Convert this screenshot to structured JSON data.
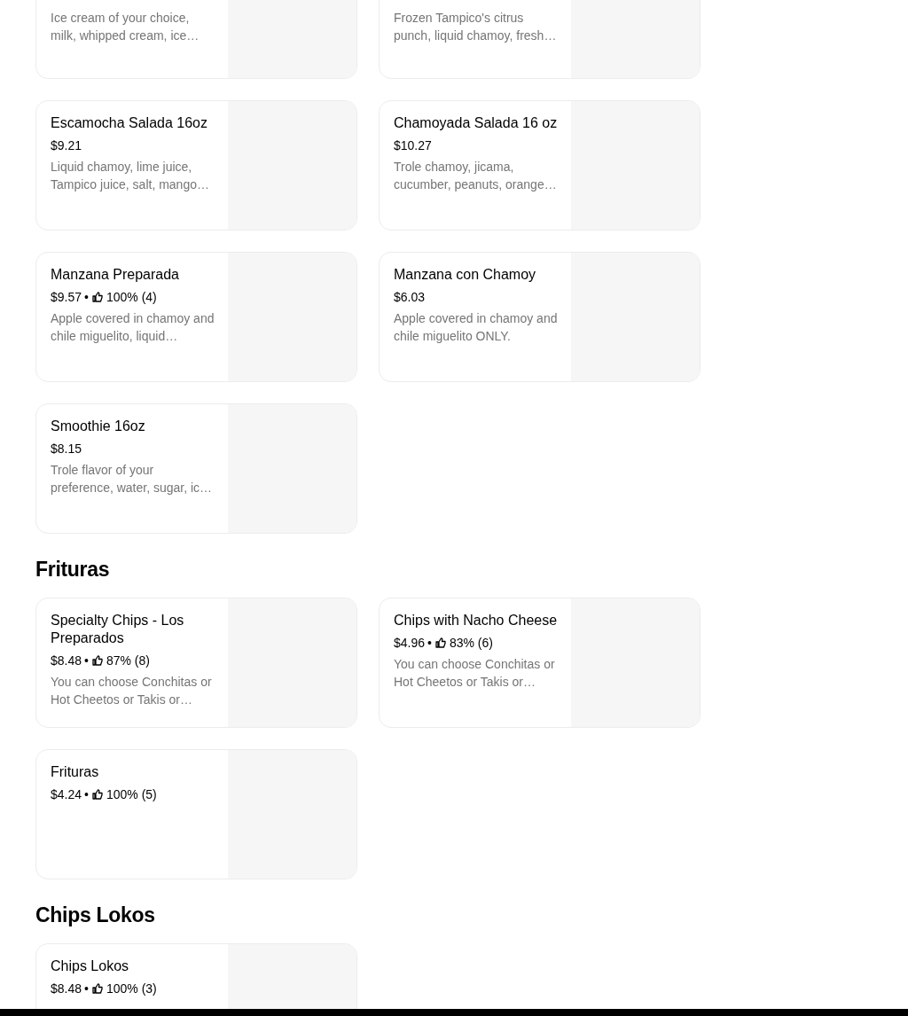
{
  "sections": [
    {
      "items": [
        {
          "description": "Ice cream of your choice, milk, whipped cream, ice…"
        },
        {
          "description": "Frozen Tampico's citrus punch, liquid chamoy, fresh…"
        },
        {
          "title": "Escamocha Salada 16oz",
          "price": "$9.21",
          "description": "Liquid chamoy, lime juice, Tampico juice, salt, mango…"
        },
        {
          "title": "Chamoyada Salada 16 oz",
          "price": "$10.27",
          "description": "Trole chamoy, jicama, cucumber, peanuts, orange…"
        },
        {
          "title": "Manzana Preparada",
          "price": "$9.57",
          "separator": "•",
          "rating": "100% (4)",
          "description": "Apple covered in chamoy and chile miguelito, liquid…"
        },
        {
          "title": "Manzana con Chamoy",
          "price": "$6.03",
          "description": "Apple covered in chamoy and chile miguelito ONLY."
        },
        {
          "title": "Smoothie 16oz",
          "price": "$8.15",
          "description": "Trole flavor of your preference, water, sugar, ic…"
        }
      ]
    },
    {
      "title": "Frituras",
      "items": [
        {
          "title": "Specialty Chips - Los Preparados",
          "price": "$8.48",
          "separator": "•",
          "rating": "87% (8)",
          "description": "You can choose Conchitas or Hot Cheetos or Takis or…"
        },
        {
          "title": "Chips with Nacho Cheese",
          "price": "$4.96",
          "separator": "•",
          "rating": "83% (6)",
          "description": "You can choose Conchitas or Hot Cheetos or Takis or…"
        },
        {
          "title": "Frituras",
          "price": "$4.24",
          "separator": "•",
          "rating": "100% (5)"
        }
      ]
    },
    {
      "title": "Chips Lokos",
      "items": [
        {
          "title": "Chips Lokos",
          "price": "$8.48",
          "separator": "•",
          "rating": "100% (3)"
        }
      ]
    }
  ]
}
